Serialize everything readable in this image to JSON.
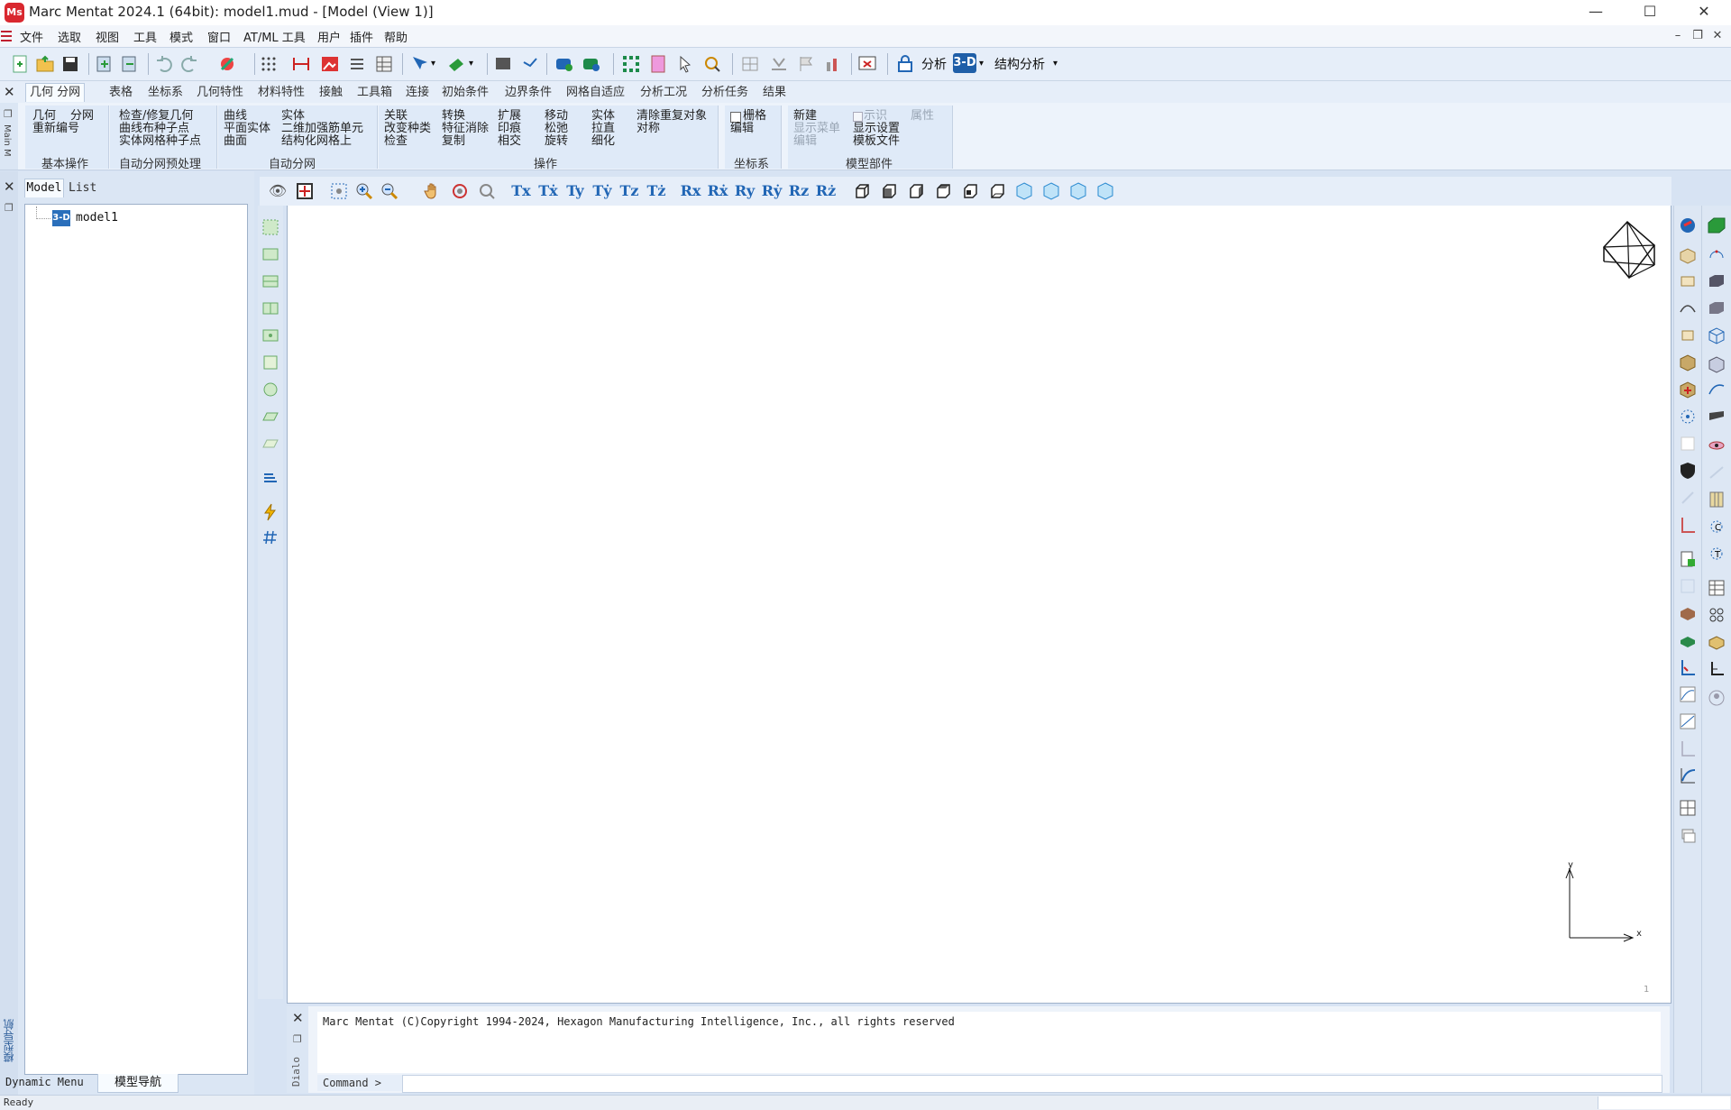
{
  "window": {
    "app_icon_text": "Ms",
    "title": "Marc Mentat 2024.1 (64bit): model1.mud - [Model (View 1)]",
    "controls": {
      "minimize": "—",
      "maximize": "☐",
      "close": "✕"
    }
  },
  "menubar": {
    "items": [
      "文件",
      "选取",
      "视图",
      "工具",
      "模式",
      "窗口",
      "AT/ML 工具",
      "用户",
      "插件",
      "帮助"
    ],
    "mdi_controls": {
      "minimize": "–",
      "restore": "❐",
      "close": "✕"
    }
  },
  "toolbar": {
    "analysis_label": "分析",
    "dimension_badge": "3-D",
    "analysis_class": "结构分析",
    "dropdown_arrow": "▾"
  },
  "ribbon": {
    "close": "✕",
    "side_label": "Main M",
    "tabs": [
      "几何 分网",
      "表格",
      "坐标系",
      "几何特性",
      "材料特性",
      "接触",
      "工具箱",
      "连接",
      "初始条件",
      "边界条件",
      "网格自适应",
      "分析工况",
      "分析任务",
      "结果"
    ],
    "active_tab_index": 0,
    "groups": [
      {
        "label": "基本操作",
        "items": [
          "几何",
          "分网",
          "重新编号"
        ]
      },
      {
        "label": "自动分网预处理",
        "items": [
          "检查/修复几何",
          "曲线布种子点",
          "实体网格种子点"
        ]
      },
      {
        "label": "自动分网",
        "items": [
          "曲线",
          "实体",
          "平面实体",
          "二维加强筋单元",
          "曲面",
          "结构化网格上"
        ]
      },
      {
        "label": "操作",
        "items": [
          "关联",
          "转换",
          "扩展",
          "移动",
          "实体",
          "清除重复对象",
          "改变种类",
          "特征消除",
          "印痕",
          "松弛",
          "拉直",
          "对称",
          "检查",
          "复制",
          "相交",
          "旋转",
          "细化"
        ]
      },
      {
        "label": "坐标系",
        "items": [
          "栅格",
          "编辑"
        ]
      },
      {
        "label": "模型部件",
        "items": [
          "新建",
          "示识",
          "属性",
          "显示菜单",
          "显示设置",
          "编辑",
          "模板文件"
        ]
      }
    ]
  },
  "left_panel": {
    "close": "✕",
    "restore": "❐",
    "tabs": {
      "model": "Model",
      "list": "List"
    },
    "tree": {
      "icon": "3-D",
      "item": "model1"
    },
    "bottom_tabs": {
      "dynamic": "Dynamic Menu",
      "nav": "模型导航"
    },
    "strip_label": "模型导航"
  },
  "viewbar": {
    "translate": [
      "Tx",
      "Tẋ",
      "Ty",
      "Tẏ",
      "Tz",
      "Tż"
    ],
    "rotate": [
      "Rx",
      "Rẋ",
      "Ry",
      "Rẏ",
      "Rz",
      "Rż"
    ]
  },
  "viewport": {
    "axis_x": "x",
    "axis_y": "y",
    "view_number": "1"
  },
  "dialog": {
    "close": "✕",
    "restore": "❐",
    "side_label": "Dialo",
    "message": "Marc Mentat (C)Copyright 1994-2024, Hexagon Manufacturing Intelligence, Inc., all rights reserved",
    "command_label": "Command >"
  },
  "status": {
    "text": "Ready"
  },
  "colors": {
    "accent": "#1f5fa8",
    "panel": "#dbe6f4",
    "viewport_bg": "#ffffff"
  }
}
